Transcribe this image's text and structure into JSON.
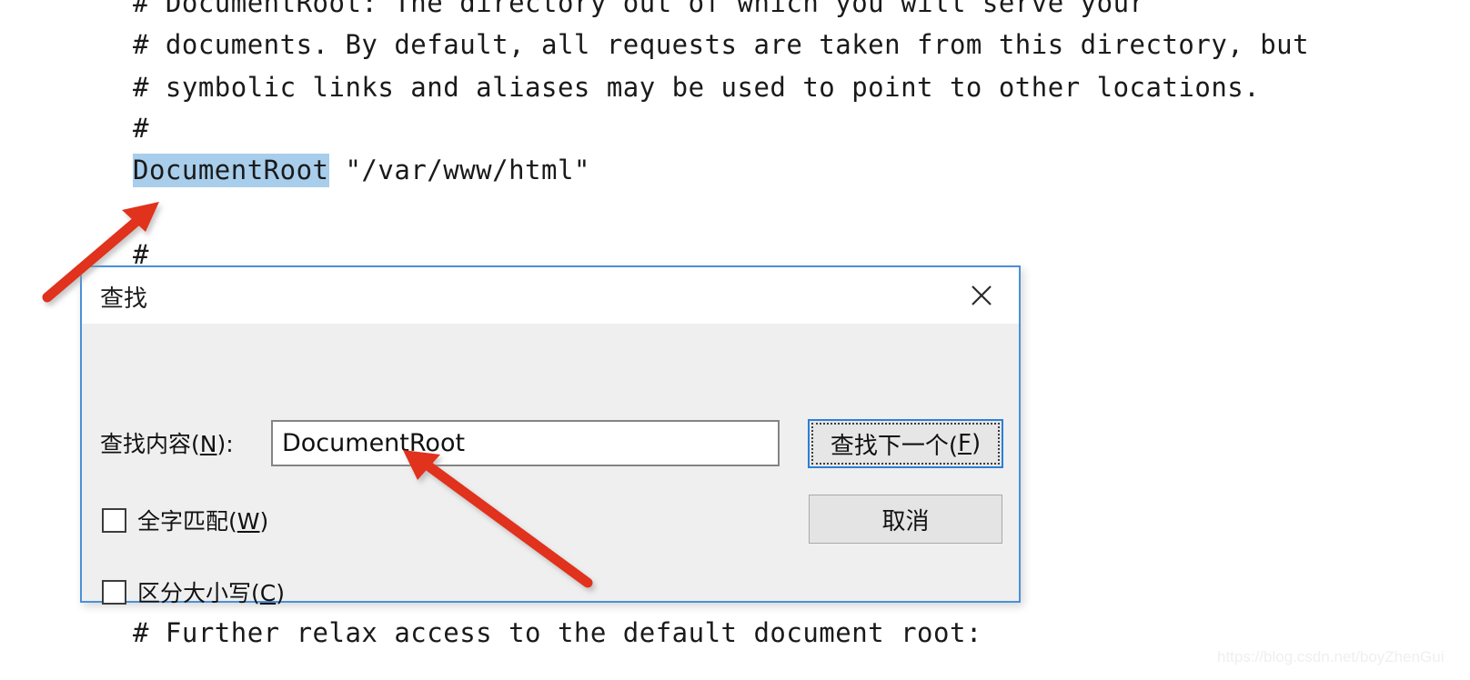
{
  "editor": {
    "lines": [
      "# DocumentRoot: The directory out of which you will serve your",
      "# documents. By default, all requests are taken from this directory, but",
      "# symbolic links and aliases may be used to point to other locations.",
      "#",
      "#",
      "# Further relax access to the default document root:"
    ],
    "highlighted_line": {
      "selected_token": "DocumentRoot",
      "rest": " \"/var/www/html\"",
      "selection_color": "#a8ceec"
    }
  },
  "dialog": {
    "title": "查找",
    "close_icon": "close-icon",
    "find_label_prefix": "查找内容(",
    "find_label_accel": "N",
    "find_label_suffix": "):",
    "find_input_value": "DocumentRoot",
    "find_input_placeholder": "",
    "buttons": {
      "find_next_prefix": "查找下一个(",
      "find_next_accel": "F",
      "find_next_suffix": ")",
      "cancel": "取消"
    },
    "checkboxes": [
      {
        "prefix": "全字匹配(",
        "accel": "W",
        "suffix": ")",
        "checked": false
      },
      {
        "prefix": "区分大小写(",
        "accel": "C",
        "suffix": ")",
        "checked": false
      }
    ],
    "border_color": "#4a90d9",
    "background_color": "#efefef"
  },
  "annotations": {
    "arrow_color": "#e0301e",
    "arrow_1_target": "DocumentRoot",
    "arrow_2_target": "find-input"
  },
  "watermark": {
    "text": "https://blog.csdn.net/boyZhenGui"
  }
}
